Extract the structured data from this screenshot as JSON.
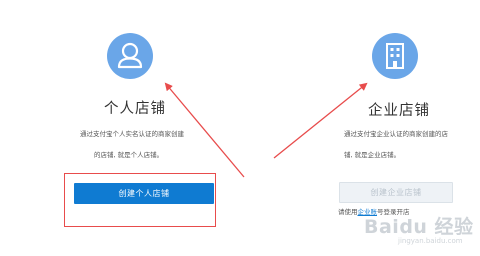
{
  "personal_shop": {
    "title": "个人店铺",
    "description_line1": "通过支付宝个人实名认证的商家创建",
    "description_line2": "的店铺, 就是个人店铺。",
    "button_label": "创建个人店铺"
  },
  "enterprise_shop": {
    "title": "企业店铺",
    "description_line1": "通过支付宝企业认证的商家创建的店",
    "description_line2": "铺, 就是企业店铺。",
    "button_label": "创建企业店铺",
    "hint_prefix": "请使用",
    "hint_link": "企业账",
    "hint_suffix": "号登录开店"
  },
  "watermark": {
    "logo_text": "Baidu 经验",
    "url_text": "jingyan.baidu.com"
  },
  "colors": {
    "accent_blue": "#0f7bd2",
    "icon_circle": "#6aa6e8",
    "annotation_red": "#e84c4c"
  }
}
